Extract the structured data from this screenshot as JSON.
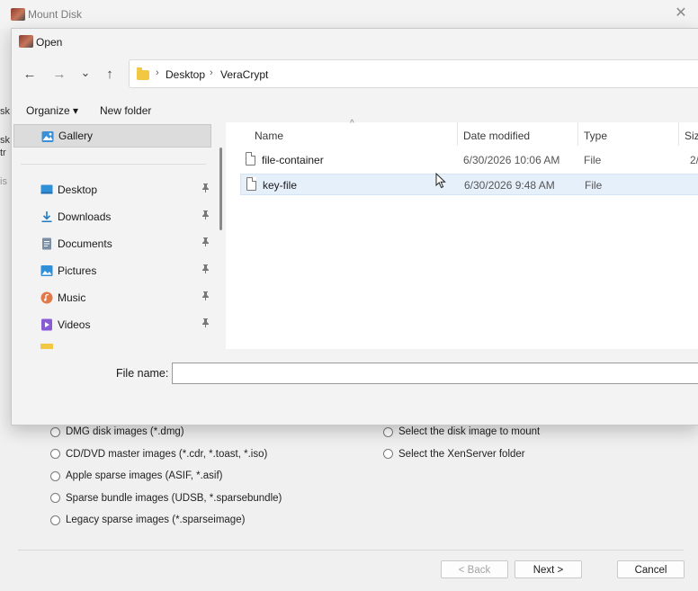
{
  "mount_window": {
    "title": "Mount Disk",
    "close_glyph": "✕",
    "peek_letters": [
      "sk",
      "sk",
      "tr",
      "is"
    ],
    "options_left": [
      "DMG disk images (*.dmg)",
      "CD/DVD master images (*.cdr, *.toast, *.iso)",
      "Apple sparse images (ASIF, *.asif)",
      "Sparse bundle images (UDSB, *.sparsebundle)",
      "Legacy sparse images (*.sparseimage)"
    ],
    "options_right": [
      "Select the disk image to mount",
      "Select the XenServer folder"
    ],
    "buttons": {
      "back": "< Back",
      "next": "Next >",
      "cancel": "Cancel"
    }
  },
  "open_dialog": {
    "title": "Open",
    "nav_glyphs": {
      "back": "←",
      "forward": "→",
      "recent": "⌄",
      "up": "↑"
    },
    "breadcrumb": [
      "Desktop",
      "VeraCrypt"
    ],
    "breadcrumb_sep": "›",
    "toolbar": {
      "organize": "Organize ▾",
      "new_folder": "New folder"
    },
    "nav_pane": {
      "gallery": "Gallery",
      "items": [
        {
          "label": "Desktop",
          "icon": "desktop-icon",
          "color": "#2f8fd8"
        },
        {
          "label": "Downloads",
          "icon": "download-icon",
          "color": "#1f7bc4"
        },
        {
          "label": "Documents",
          "icon": "documents-icon",
          "color": "#7a8ea6"
        },
        {
          "label": "Pictures",
          "icon": "pictures-icon",
          "color": "#2f8fd8"
        },
        {
          "label": "Music",
          "icon": "music-icon",
          "color": "#e07a4a"
        },
        {
          "label": "Videos",
          "icon": "videos-icon",
          "color": "#8a5bd6"
        }
      ],
      "pin_glyph": "📌"
    },
    "columns": {
      "name": "Name",
      "date_modified": "Date modified",
      "type": "Type",
      "size": "Siz"
    },
    "sort_caret": "^",
    "files": [
      {
        "name": "file-container",
        "date": "6/30/2026 10:06 AM",
        "type": "File",
        "size": "2/"
      },
      {
        "name": "key-file",
        "date": "6/30/2026 9:48 AM",
        "type": "File",
        "size": ""
      }
    ],
    "filename": {
      "label": "File name:",
      "value": ""
    }
  },
  "colors": {
    "selection": "#e6f0fb",
    "folder": "#f2c744",
    "accent": "#2f8fd8"
  }
}
